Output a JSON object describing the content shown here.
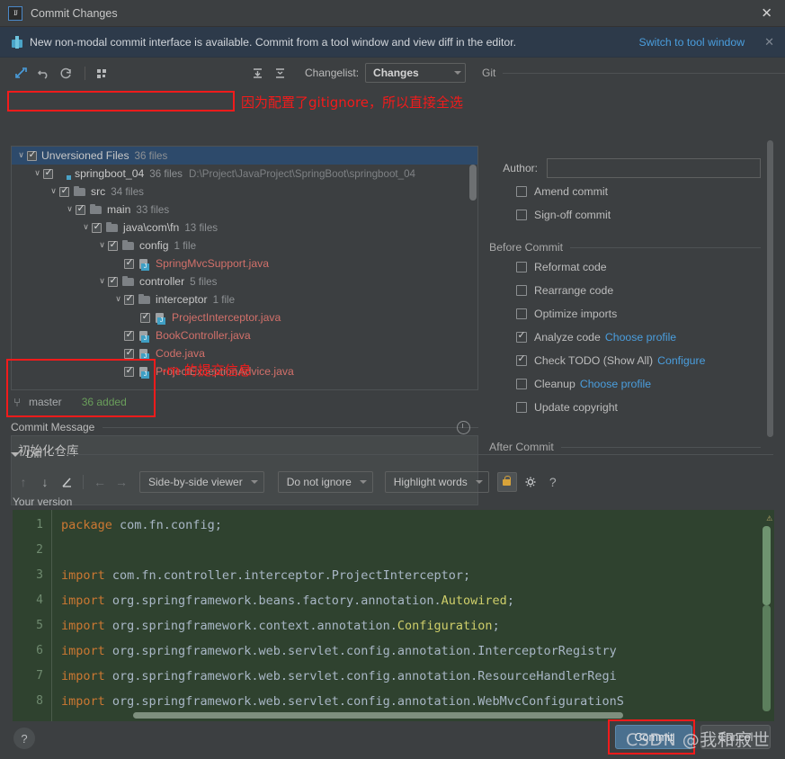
{
  "window": {
    "title": "Commit Changes",
    "icon": "intellij-idea-icon",
    "close_label": "✕"
  },
  "banner": {
    "icon": "gift-icon",
    "text": "New non-modal commit interface is available. Commit from a tool window and view diff in the editor.",
    "link": "Switch to tool window",
    "close_label": "✕"
  },
  "toolbar": {
    "icons": [
      {
        "name": "show-diff-icon",
        "glyph": "✶"
      },
      {
        "name": "revert-icon",
        "glyph": "↶"
      },
      {
        "name": "refresh-icon",
        "glyph": "↻"
      },
      {
        "name": "group-by-icon",
        "glyph": "☷"
      }
    ],
    "expand_all_icon": "expand-all-icon",
    "collapse_all_icon": "collapse-all-icon",
    "changelist_label": "Changelist:",
    "changelist_value": "Changes",
    "git_group_label": "Git"
  },
  "tree": {
    "scroll_present": true,
    "rows": [
      {
        "indent": 0,
        "chevron": "∨",
        "checked": true,
        "icon": "none",
        "name": "Unversioned Files",
        "count": "36 files",
        "path": "",
        "selected": true,
        "red": false
      },
      {
        "indent": 1,
        "chevron": "∨",
        "checked": true,
        "icon": "module",
        "name": "springboot_04",
        "count": "36 files",
        "path": "D:\\Project\\JavaProject\\SpringBoot\\springboot_04",
        "selected": false,
        "red": false
      },
      {
        "indent": 2,
        "chevron": "∨",
        "checked": true,
        "icon": "folder",
        "name": "src",
        "count": "34 files",
        "path": "",
        "selected": false,
        "red": false
      },
      {
        "indent": 3,
        "chevron": "∨",
        "checked": true,
        "icon": "folder",
        "name": "main",
        "count": "33 files",
        "path": "",
        "selected": false,
        "red": false
      },
      {
        "indent": 4,
        "chevron": "∨",
        "checked": true,
        "icon": "folder",
        "name": "java\\com\\fn",
        "count": "13 files",
        "path": "",
        "selected": false,
        "red": false
      },
      {
        "indent": 5,
        "chevron": "∨",
        "checked": true,
        "icon": "folder",
        "name": "config",
        "count": "1 file",
        "path": "",
        "selected": false,
        "red": false
      },
      {
        "indent": 6,
        "chevron": "",
        "checked": true,
        "icon": "java",
        "name": "SpringMvcSupport.java",
        "count": "",
        "path": "",
        "selected": false,
        "red": true
      },
      {
        "indent": 5,
        "chevron": "∨",
        "checked": true,
        "icon": "folder",
        "name": "controller",
        "count": "5 files",
        "path": "",
        "selected": false,
        "red": false
      },
      {
        "indent": 6,
        "chevron": "∨",
        "checked": true,
        "icon": "folder",
        "name": "interceptor",
        "count": "1 file",
        "path": "",
        "selected": false,
        "red": false
      },
      {
        "indent": 7,
        "chevron": "",
        "checked": true,
        "icon": "java",
        "name": "ProjectInterceptor.java",
        "count": "",
        "path": "",
        "selected": false,
        "red": true
      },
      {
        "indent": 6,
        "chevron": "",
        "checked": true,
        "icon": "java",
        "name": "BookController.java",
        "count": "",
        "path": "",
        "selected": false,
        "red": true
      },
      {
        "indent": 6,
        "chevron": "",
        "checked": true,
        "icon": "java",
        "name": "Code.java",
        "count": "",
        "path": "",
        "selected": false,
        "red": true
      },
      {
        "indent": 6,
        "chevron": "",
        "checked": true,
        "icon": "java",
        "name": "ProjectExceptionAdvice.java",
        "count": "",
        "path": "",
        "selected": false,
        "red": true
      }
    ]
  },
  "branch_status": {
    "icon": "branch-icon",
    "branch": "master",
    "added": "36 added"
  },
  "commit_message": {
    "label": "Commit Message",
    "value": "初始化仓库",
    "history_icon": "history-clock-icon"
  },
  "options": {
    "git_section": "Git",
    "author_label": "Author:",
    "author_value": "",
    "git_checks": [
      {
        "label": "Amend commit",
        "checked": false,
        "link": ""
      },
      {
        "label": "Sign-off commit",
        "checked": false,
        "link": ""
      }
    ],
    "before_commit_section": "Before Commit",
    "before_commit": [
      {
        "label": "Reformat code",
        "checked": false,
        "link": ""
      },
      {
        "label": "Rearrange code",
        "checked": false,
        "link": ""
      },
      {
        "label": "Optimize imports",
        "checked": false,
        "link": ""
      },
      {
        "label": "Analyze code",
        "checked": true,
        "link": "Choose profile"
      },
      {
        "label": "Check TODO (Show All)",
        "checked": true,
        "link": "Configure"
      },
      {
        "label": "Cleanup",
        "checked": false,
        "link": "Choose profile"
      },
      {
        "label": "Update copyright",
        "checked": false,
        "link": ""
      }
    ],
    "after_commit_section": "After Commit"
  },
  "diff": {
    "section_title": "Diff",
    "buttons": [
      {
        "name": "previous-difference-icon",
        "glyph": "↑",
        "dim": true
      },
      {
        "name": "next-difference-icon",
        "glyph": "↓",
        "dim": false
      },
      {
        "name": "edit-source-icon",
        "glyph": "✎",
        "dim": false
      },
      {
        "name": "apply-left-icon",
        "glyph": "←",
        "dim": true
      },
      {
        "name": "apply-right-icon",
        "glyph": "→",
        "dim": true
      }
    ],
    "viewer_mode": "Side-by-side viewer",
    "ignore_mode": "Do not ignore",
    "highlight_mode": "Highlight words",
    "lock_icon": "lock-icon",
    "settings_icon": "gear-icon",
    "help_icon": "question-mark-icon",
    "your_version_label": "Your version",
    "warning_marker": "⚠",
    "code_lines": [
      {
        "num": "1",
        "tokens": [
          {
            "t": "package",
            "c": "kw"
          },
          {
            "t": " com.fn.config;",
            "c": "plain"
          }
        ]
      },
      {
        "num": "2",
        "tokens": []
      },
      {
        "num": "3",
        "tokens": [
          {
            "t": "import",
            "c": "kw"
          },
          {
            "t": " com.fn.controller.interceptor.ProjectInterceptor;",
            "c": "plain"
          }
        ]
      },
      {
        "num": "4",
        "tokens": [
          {
            "t": "import",
            "c": "kw"
          },
          {
            "t": " org.springframework.beans.factory.annotation.",
            "c": "plain"
          },
          {
            "t": "Autowired",
            "c": "cls"
          },
          {
            "t": ";",
            "c": "plain"
          }
        ]
      },
      {
        "num": "5",
        "tokens": [
          {
            "t": "import",
            "c": "kw"
          },
          {
            "t": " org.springframework.context.annotation.",
            "c": "plain"
          },
          {
            "t": "Configuration",
            "c": "cls"
          },
          {
            "t": ";",
            "c": "plain"
          }
        ]
      },
      {
        "num": "6",
        "tokens": [
          {
            "t": "import",
            "c": "kw"
          },
          {
            "t": " org.springframework.web.servlet.config.annotation.InterceptorRegistry",
            "c": "plain"
          }
        ]
      },
      {
        "num": "7",
        "tokens": [
          {
            "t": "import",
            "c": "kw"
          },
          {
            "t": " org.springframework.web.servlet.config.annotation.ResourceHandlerRegi",
            "c": "plain"
          }
        ]
      },
      {
        "num": "8",
        "tokens": [
          {
            "t": "import",
            "c": "kw"
          },
          {
            "t": " org.springframework.web.servlet.config.annotation.WebMvcConfigurationS",
            "c": "plain"
          }
        ]
      }
    ]
  },
  "footer": {
    "help_label": "?",
    "commit_label": "Commit",
    "cancel_label": "Cancel"
  },
  "annotations": {
    "tree_note": "因为配置了gitignore，所以直接全选",
    "commit_note": "-m 的提交信息",
    "color": "#f21b1b"
  },
  "watermark": {
    "text": "CSDN @我和寂世"
  }
}
